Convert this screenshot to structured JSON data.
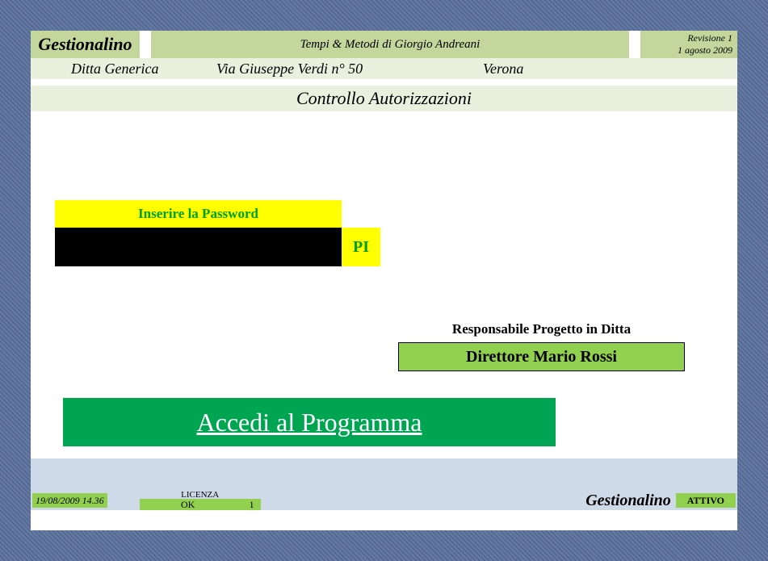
{
  "header": {
    "brand": "Gestionalino",
    "center": "Tempi & Metodi di Giorgio Andreani",
    "revision_line1": "Revisione 1",
    "revision_line2": "1 agosto 2009"
  },
  "company": {
    "name": "Ditta Generica",
    "address": "Via Giuseppe Verdi   n° 50",
    "city": "Verona"
  },
  "section_title": "Controllo Autorizzazioni",
  "password": {
    "label": "Inserire la Password",
    "value": "",
    "code": "PI"
  },
  "responsible": {
    "title": "Responsabile Progetto in Ditta",
    "value": "Direttore Mario Rossi"
  },
  "access_button": "Accedi al Programma",
  "status": {
    "datetime": "19/08/2009 14.36",
    "license_label": "LICENZA",
    "license_status": "OK",
    "license_num": "1",
    "brand": "Gestionalino",
    "active": "ATTIVO"
  }
}
